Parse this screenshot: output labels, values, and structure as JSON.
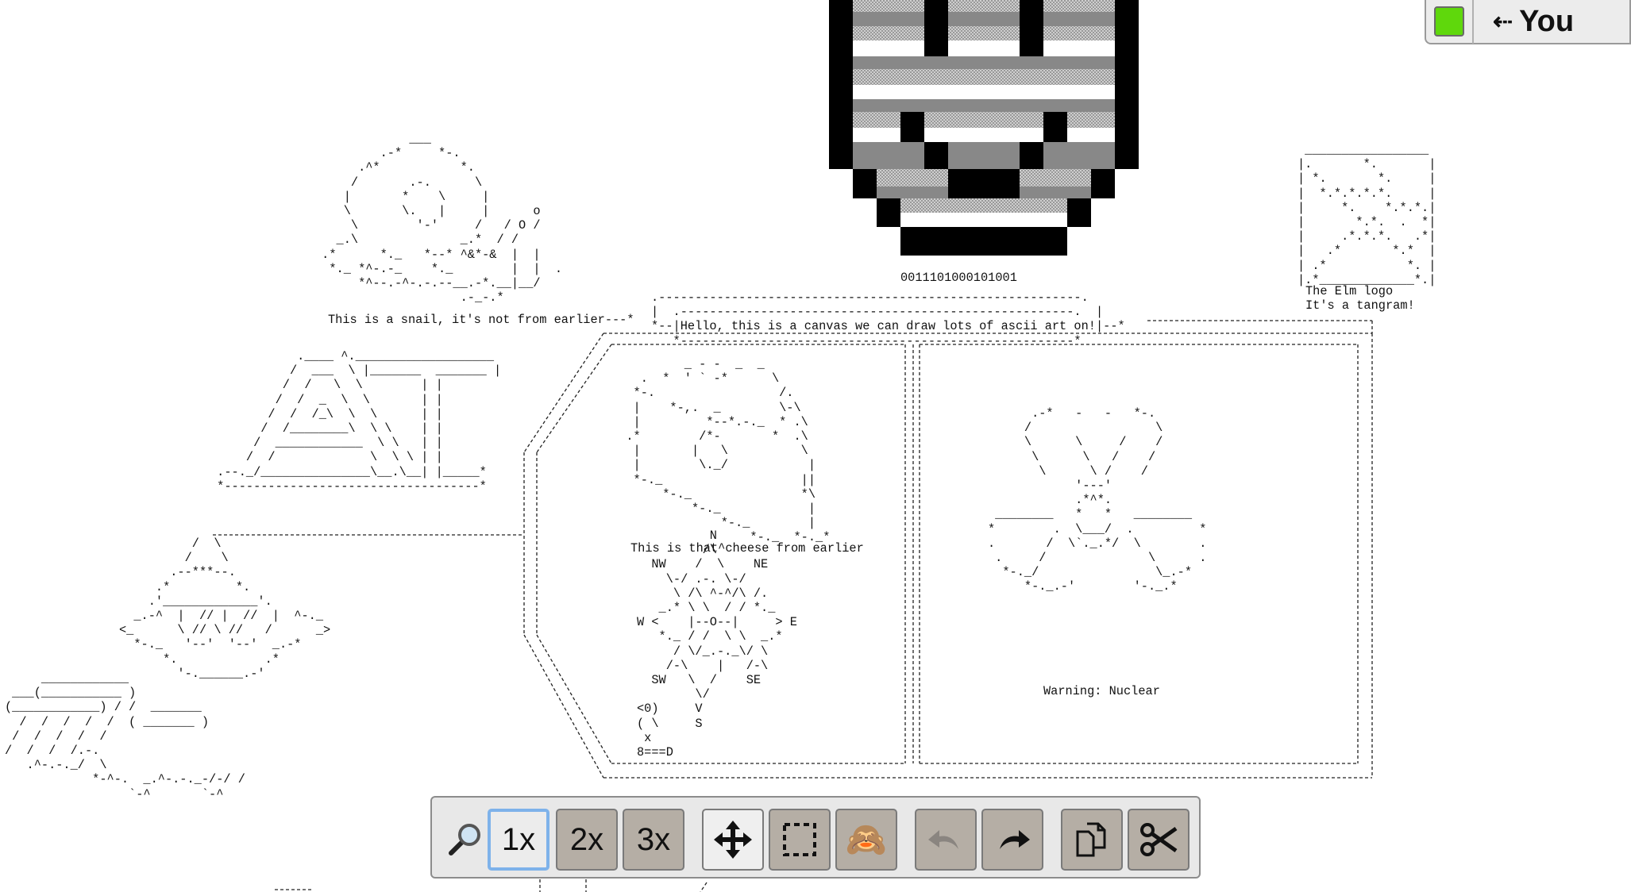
{
  "canvas": {
    "binary_label": "0011101000101001",
    "elm_caption": "The Elm logo\nIt's a tangram!",
    "art_hello": ".----------------------------------------------------------.\n|  .------------------------------------------------------.  |\n*--|Hello, this is a canvas we can draw lots of ascii art on!|--*\n   *------------------------------------------------------*",
    "art_snail": "             ___\n         .-*     *-.\n      .^*           *.\n     /       .-.      \\\n    |       *    \\     |\n    \\       \\.   |     |      o\n     \\        '-'     /   / O /\n   _.\\              _.*  / /\n .*      *._   *--* ^&*-&  |  |\n  *._ *^-.-_    *._        |  |  .\n      *^--.-^-.-.--__.-*.__|__/\n                    .-_-.*",
    "art_snail_caption": "This is a snail, it's not from earlier---*",
    "art_at": "            .____ ^.___________________\n           /  ___  \\ |_______  _______ |\n          /  /   \\  \\        | |\n         /  /  _  \\  \\       | |\n        /  /  /_\\  \\  \\      | |\n       /  /________\\  \\ \\    | |\n      /  ____________  \\ \\   | |\n     /  /             \\  \\ \\ | |\n .--._/_______________\\__.\\__| |_____*\n *-----------------------------------*",
    "art_cheese": "          _ - -  _  _\n    .  *  ' ` -*      \\\n   *-.                 /.\n   |    *-,.  _        \\-\\\n   |         *--*.-._  * .\\\n  .*        /*-       *  .\\\n   |       |   \\          \\\n   |        \\._/           |\n   *-._                   ||\n       *-._               *\\\n           *-._            |\n               *-._        |\n                   *-._  *-._*",
    "art_cheese_caption": "This is that^cheese from earlier",
    "art_compass": "          N\n         /\\\n  NW    /  \\    NE\n    \\-/ .-. \\-/\n     \\ /\\ ^-^/\\ /.\n   _.* \\ \\  / / *._\nW <    |--O--|     > E\n   *._ / /  \\ \\  _.*\n     / \\/_.-._\\/ \\\n    /-\\    |   /-\\\n  SW   \\  /    SE\n        \\/\n<0)     V\n( \\     S\n x\n8===D",
    "art_sun": "          /  \\\n         /    \\\n       .--***--.\n     .*         *.\n    .'_____________'.\n  _.-^  |  // |  //  |  ^-._\n<_      \\ // \\ //   /      _>\n  *-._   '--'  '--'  _.-*\n      *.            .*\n        '-.______.-'",
    "art_clouds": "     ____________\n ___(___________ )\n(____________) / /  _______\n  /  /  /  /  /  ( _______ )\n /  /  /  /  /\n/  /  /  /.-.\n   .^-.-._/  \\\n            *-^-.  _.^-.-._-/-/ /\n                 `-^       `-^",
    "art_radiation": "      .-*   -   -   *-.\n     /                 \\\n     \\      \\     /    /\n      \\      \\   /    /\n       \\      \\ /    /\n            '---'\n            .*^*.\n ________   *   *   ________\n*        .  \\___/  .         *\n.       /  \\`._.*/  \\        .\n .     /              \\      .\n  *-._/                \\_.-*\n     *-._.-'        '-._.*",
    "art_radiation_caption": "Warning: Nuclear",
    "art_tangram": " _________________\n|.       *.       |\n| *.       *.     |\n|  *.*.*.*.*.     |\n|     *.    *.*.*.|\n|       *.*.  .  *|\n|     .*.*.*.   .*|\n|   .*       *.*  |\n| .*           *. |\n|.*_____________*.|"
  },
  "user": {
    "label": "You",
    "arrow": "⇠",
    "color": "#5fd80c"
  },
  "toolbar": {
    "zoom_icon": "magnifier-icon",
    "zoom_options": [
      "1x",
      "2x",
      "3x"
    ],
    "active_zoom": "1x",
    "tools": [
      "move-icon",
      "select-icon",
      "see-no-evil-monkey-icon"
    ],
    "history": [
      "undo-icon",
      "redo-icon"
    ],
    "clipboard": [
      "copy-icon",
      "cut-icon"
    ],
    "monkey_glyph": "🙈"
  }
}
